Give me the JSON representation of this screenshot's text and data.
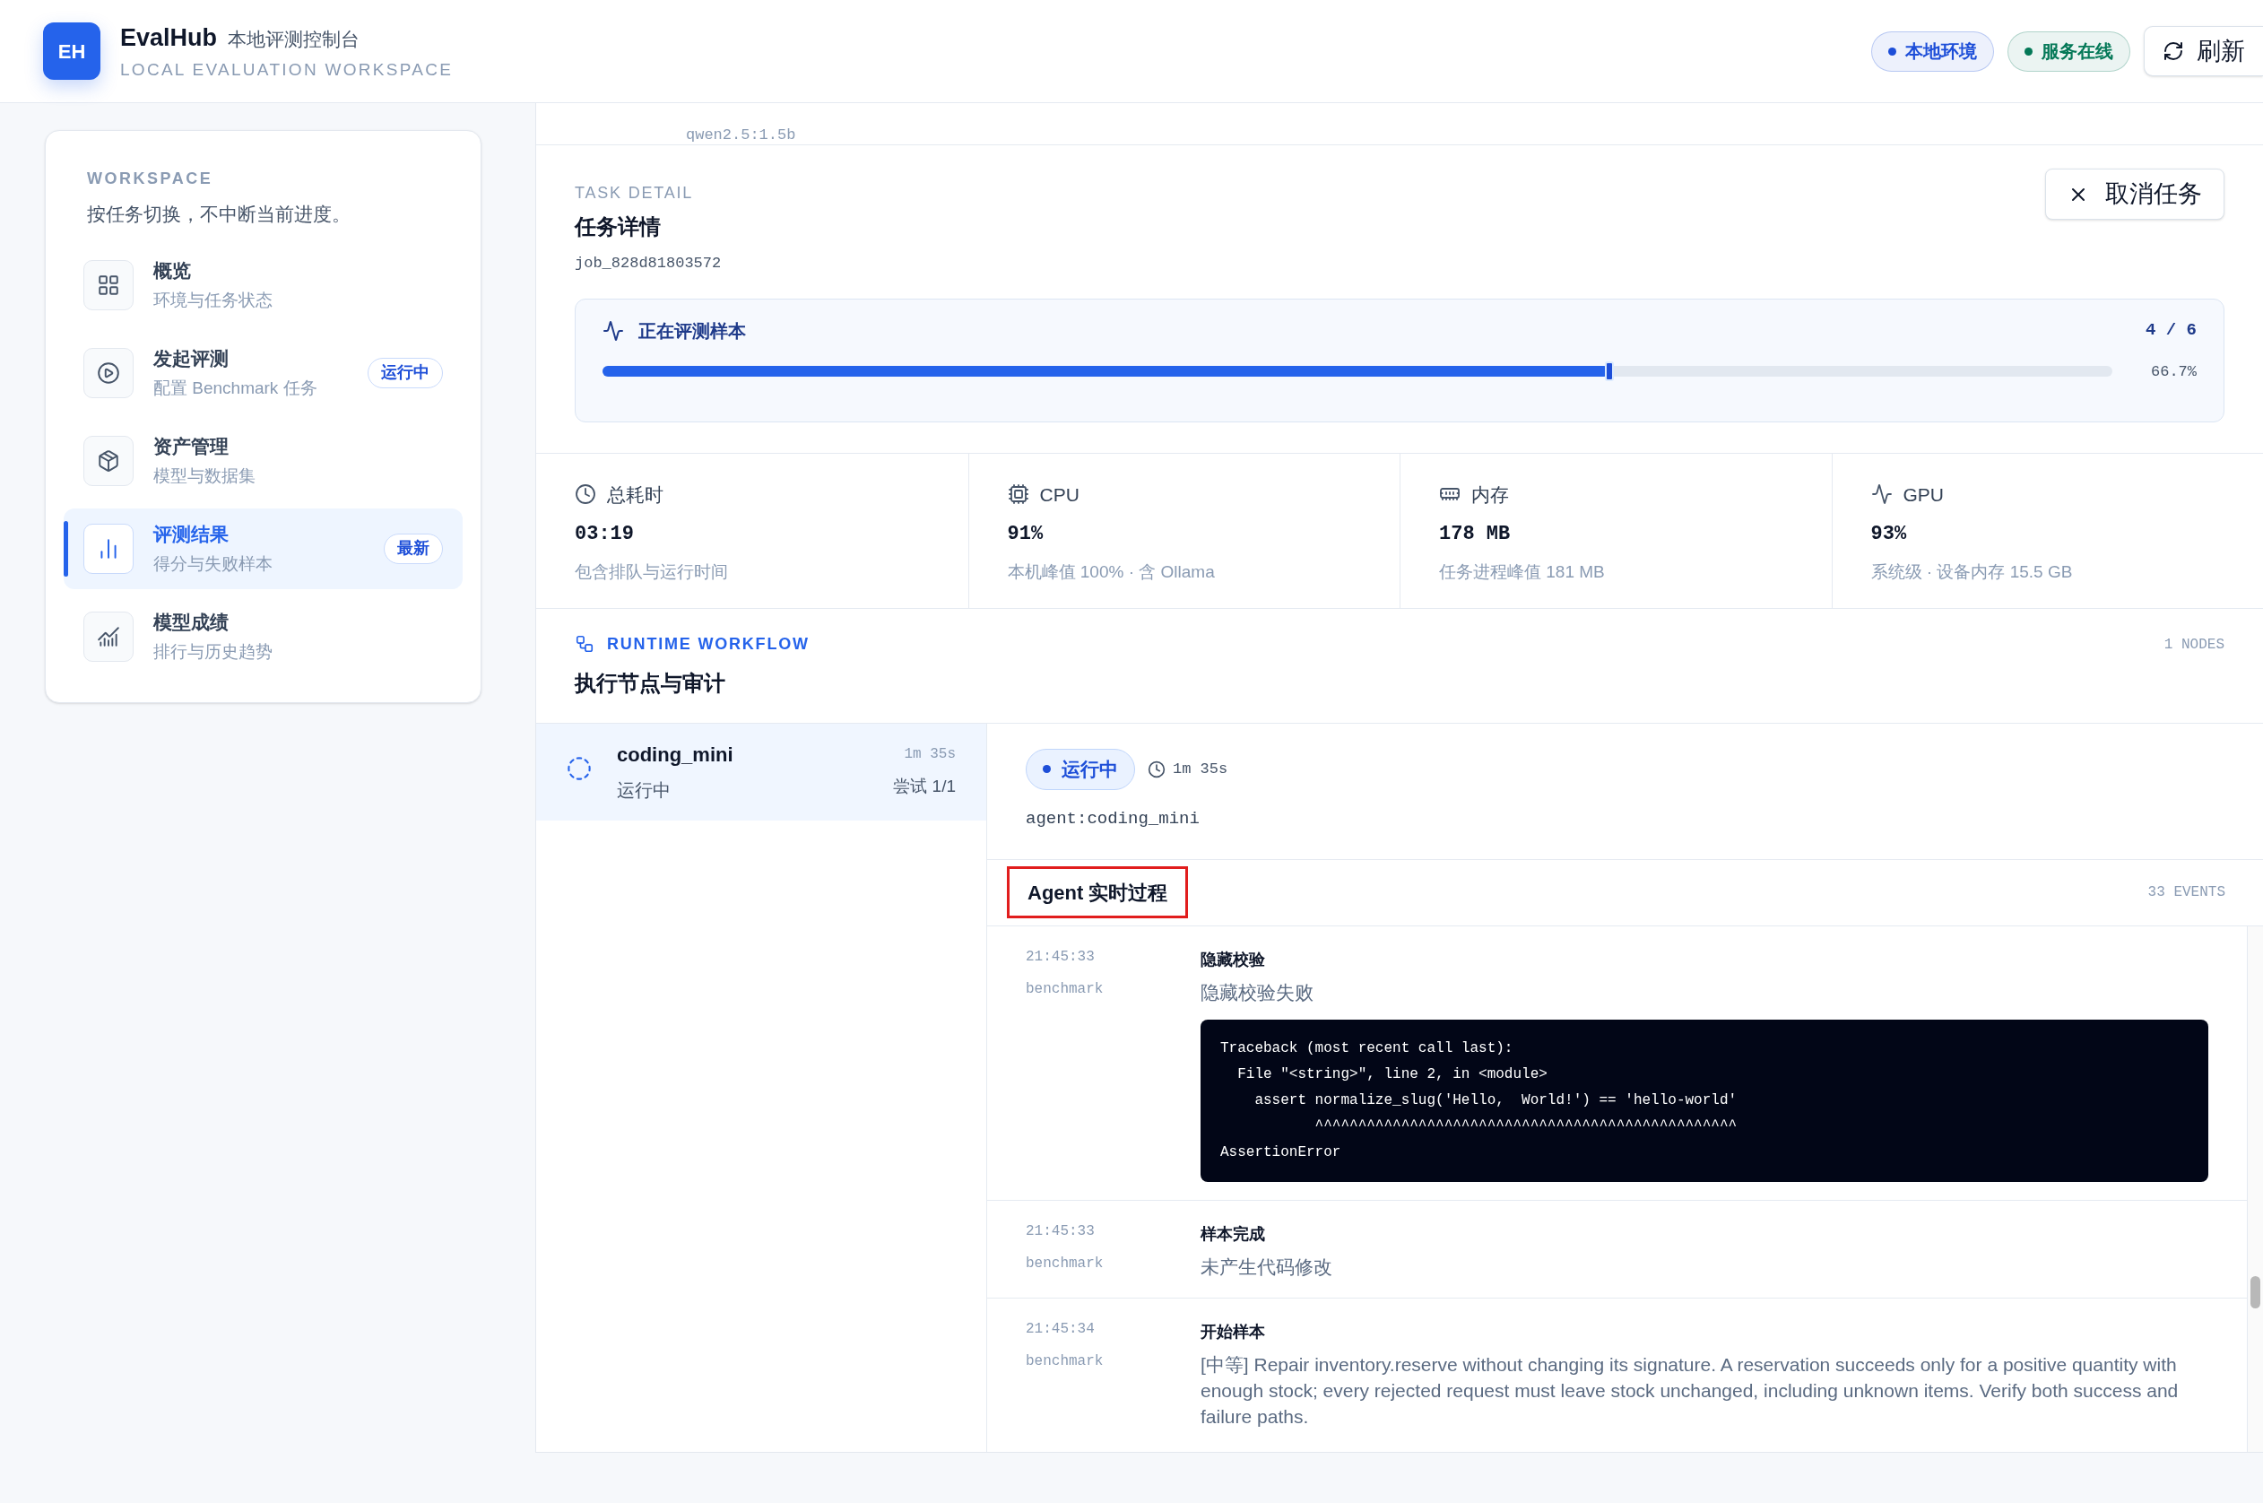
{
  "header": {
    "logo": "EH",
    "title": "EvalHub",
    "subtitle": "本地评测控制台",
    "tagline": "LOCAL EVALUATION WORKSPACE",
    "badges": [
      {
        "label": "本地环境",
        "color": "#1d4ed8"
      },
      {
        "label": "服务在线",
        "color": "#047857"
      }
    ],
    "refresh": "刷新"
  },
  "sidebar": {
    "heading": "WORKSPACE",
    "description": "按任务切换，不中断当前进度。",
    "items": [
      {
        "kind": "grid",
        "title": "概览",
        "subtitle": "环境与任务状态",
        "selected": false
      },
      {
        "kind": "play",
        "title": "发起评测",
        "subtitle": "配置 Benchmark 任务",
        "badge": "运行中",
        "selected": false
      },
      {
        "kind": "box",
        "title": "资产管理",
        "subtitle": "模型与数据集",
        "selected": false
      },
      {
        "kind": "bars",
        "title": "评测结果",
        "subtitle": "得分与失败样本",
        "badge": "最新",
        "selected": true
      },
      {
        "kind": "trend",
        "title": "模型成绩",
        "subtitle": "排行与历史趋势",
        "selected": false
      }
    ]
  },
  "scrolled_row": {
    "text": "qwen2.5:1.5b"
  },
  "task": {
    "eyebrow": "TASK DETAIL",
    "title": "任务详情",
    "id": "job_828d81803572",
    "cancel": "取消任务",
    "progress": {
      "label": "正在评测样本",
      "count": "4 / 6",
      "percent": "66.7%",
      "level": 0.667
    }
  },
  "metrics": [
    {
      "kind": "clock",
      "label": "总耗时",
      "value": "03:19",
      "note": "包含排队与运行时间"
    },
    {
      "kind": "cpu",
      "label": "CPU",
      "value": "91%",
      "note": "本机峰值 100% · 含 Ollama"
    },
    {
      "kind": "memory",
      "label": "内存",
      "value": "178 MB",
      "note": "任务进程峰值 181 MB"
    },
    {
      "kind": "gpu",
      "label": "GPU",
      "value": "93%",
      "note": "系统级 · 设备内存 15.5 GB"
    }
  ],
  "workflow": {
    "eyebrow": "RUNTIME WORKFLOW",
    "title": "执行节点与审计",
    "count": "1 NODES",
    "nodes": [
      {
        "name": "coding_mini",
        "status": "运行中",
        "duration": "1m 35s",
        "attempt": "尝试 1/1",
        "selected": true
      }
    ]
  },
  "detail": {
    "status": "运行中",
    "duration": "1m 35s",
    "agent": "agent:coding_mini",
    "events_title": "Agent 实时过程",
    "events_count": "33 EVENTS",
    "events": [
      {
        "time": "21:45:33",
        "source": "benchmark",
        "title": "隐藏校验",
        "message": "隐藏校验失败",
        "code": [
          "Traceback (most recent call last):",
          "  File \"<string>\", line 2, in <module>",
          "    assert normalize_slug('Hello,  World!') == 'hello-world'",
          "           ^^^^^^^^^^^^^^^^^^^^^^^^^^^^^^^^^^^^^^^^^^^^^^^^^",
          "AssertionError"
        ]
      },
      {
        "time": "21:45:33",
        "source": "benchmark",
        "title": "样本完成",
        "message": "未产生代码修改"
      },
      {
        "time": "21:45:34",
        "source": "benchmark",
        "title": "开始样本",
        "message": "[中等] Repair inventory.reserve without changing its signature. A reservation succeeds only for a positive quantity with enough stock; every rejected request must leave stock unchanged, including unknown items. Verify both success and failure paths."
      }
    ]
  }
}
